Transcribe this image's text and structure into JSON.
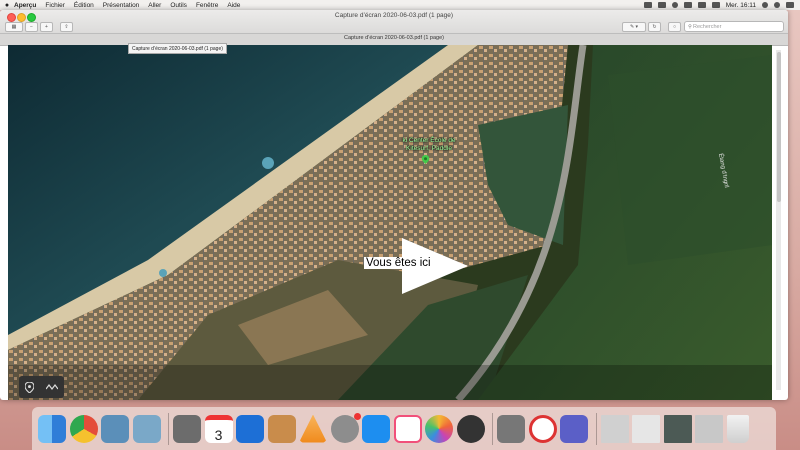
{
  "menubar": {
    "apple": "",
    "items": [
      "Aperçu",
      "Fichier",
      "Édition",
      "Présentation",
      "Aller",
      "Outils",
      "Fenêtre",
      "Aide"
    ],
    "clock": "Mer. 16:11"
  },
  "window": {
    "title": "Capture d’écran 2020-06-03.pdf (1 page)",
    "tab_title": "Capture d’écran 2020-06-03.pdf (1 page)",
    "tooltip": "Capture d’écran 2020-06-03.pdf (1 page)",
    "search_placeholder": "Rechercher"
  },
  "map": {
    "poi_label": "ki Center École de Kitesurf, Paddle",
    "lagoon_label": "Étang d'Ingril",
    "you_are_here": "Vous êtes ici"
  },
  "dock": {
    "apps": [
      {
        "name": "finder-icon",
        "color": "#3c8ee0"
      },
      {
        "name": "chrome-icon",
        "color": "#e44d3a"
      },
      {
        "name": "preview-icon",
        "color": "#5b8fb9"
      },
      {
        "name": "image-capture-icon",
        "color": "#7aa8c8"
      },
      {
        "name": "camera-icon",
        "color": "#6c6c6c"
      },
      {
        "name": "calendar-icon",
        "color": "#ffffff"
      },
      {
        "name": "bird-icon",
        "color": "#1d6fd6"
      },
      {
        "name": "book-icon",
        "color": "#c98c4b"
      },
      {
        "name": "vlc-icon",
        "color": "#f08a1c"
      },
      {
        "name": "system-preferences-icon",
        "color": "#8d8d8d"
      },
      {
        "name": "app-store-icon",
        "color": "#1d8ef0"
      },
      {
        "name": "music-icon",
        "color": "#f1507a"
      },
      {
        "name": "photos-icon",
        "color": "#f4b934"
      },
      {
        "name": "compass-icon",
        "color": "#a33"
      },
      {
        "name": "calculator-icon",
        "color": "#777"
      },
      {
        "name": "ccleaner-icon",
        "color": "#d33"
      },
      {
        "name": "teams-icon",
        "color": "#5b5fc7"
      },
      {
        "name": "window-thumb-1-icon",
        "color": "#d0d0d0"
      },
      {
        "name": "window-thumb-2-icon",
        "color": "#e6e6e6"
      },
      {
        "name": "window-thumb-3-icon",
        "color": "#556"
      },
      {
        "name": "window-thumb-4-icon",
        "color": "#c8c8c8"
      },
      {
        "name": "trash-icon",
        "color": "#dcdcdc"
      }
    ],
    "calendar_day": "3"
  }
}
